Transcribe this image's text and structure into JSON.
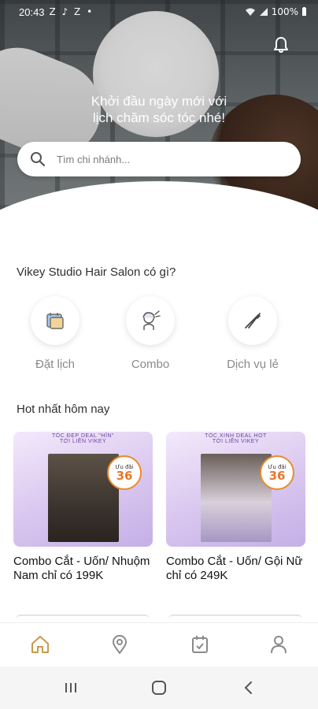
{
  "status_bar": {
    "time": "20:43",
    "notification_icons": "Z ♪ Z •",
    "battery": "100%"
  },
  "hero": {
    "tagline_line1": "Khởi đầu ngày mới với",
    "tagline_line2": "lịch chăm sóc tóc nhé!"
  },
  "search": {
    "placeholder": "Tìm chi nhánh..."
  },
  "features_section": {
    "title": "Vikey Studio Hair Salon có gì?",
    "items": [
      {
        "label": "Đặt lịch",
        "icon": "calendar-booking-icon"
      },
      {
        "label": "Combo",
        "icon": "combo-hairstyle-icon"
      },
      {
        "label": "Dịch vụ lẻ",
        "icon": "scissors-icon"
      }
    ]
  },
  "hot_section": {
    "title": "Hot nhất hôm nay",
    "cards": [
      {
        "banner_line1": "TÓC ĐẸP DEAL \"HÌN\"",
        "banner_line2": "TỚI LIỀN VIKEY",
        "badge_text": "Ưu đãi",
        "badge_value": "36",
        "name": "Combo Cắt - Uốn/ Nhuộm Nam chỉ có 199K"
      },
      {
        "banner_line1": "TÓC XINH DEAL HOT",
        "banner_line2": "TỚI LIỀN VIKEY",
        "badge_text": "Ưu đãi",
        "badge_value": "36",
        "name": "Combo Cắt - Uốn/ Gội Nữ chỉ có 249K"
      }
    ]
  },
  "bottom_nav": {
    "items": [
      "home-icon",
      "location-pin-icon",
      "calendar-check-icon",
      "profile-icon"
    ],
    "active_color": "#c89a4a",
    "inactive_color": "#8a8a8a"
  }
}
